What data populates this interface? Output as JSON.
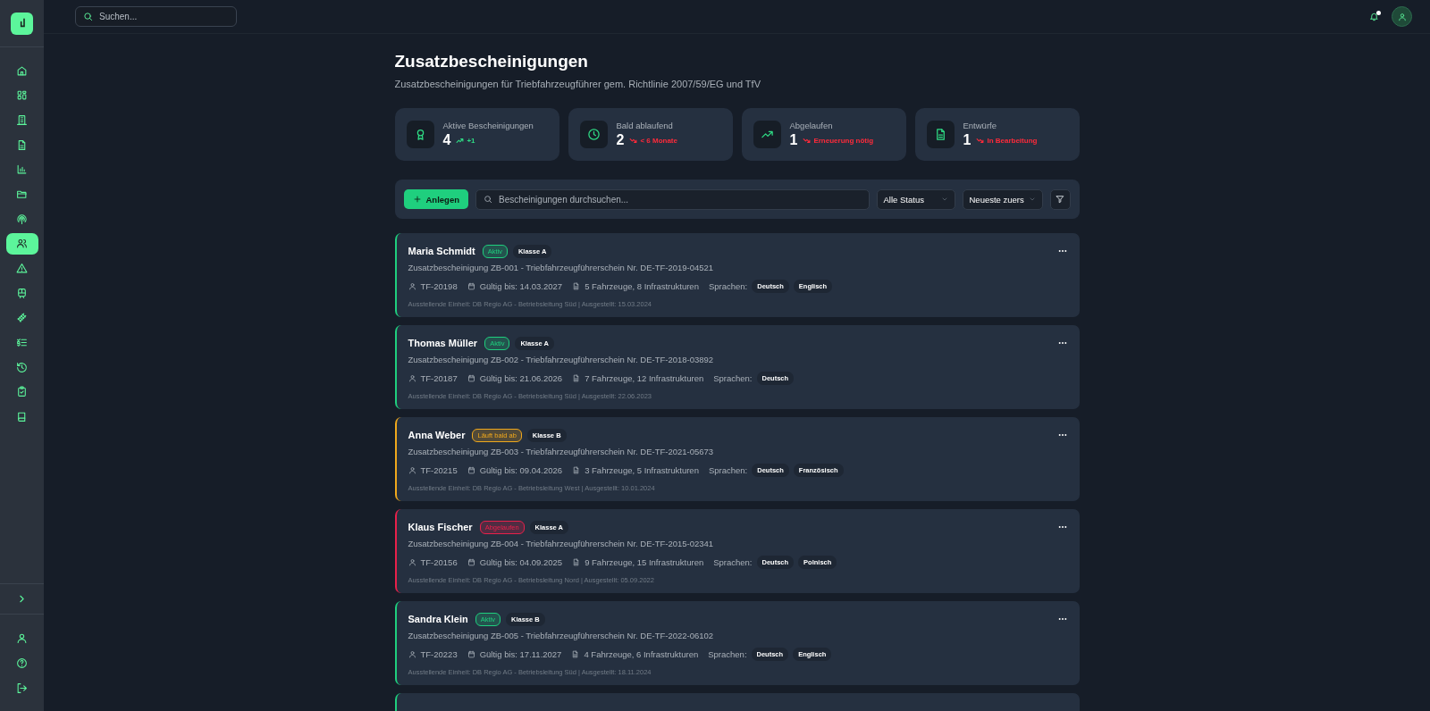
{
  "search": {
    "placeholder": "Suchen..."
  },
  "sidebar": {
    "items": [
      {
        "selected": false
      },
      {
        "selected": false
      },
      {
        "selected": false
      },
      {
        "selected": false
      },
      {
        "selected": false
      },
      {
        "selected": false
      },
      {
        "selected": false
      },
      {
        "selected": true
      },
      {
        "selected": false
      },
      {
        "selected": false
      },
      {
        "selected": false
      },
      {
        "selected": false
      },
      {
        "selected": false
      },
      {
        "selected": false
      },
      {
        "selected": false
      }
    ]
  },
  "header": {
    "notification": true
  },
  "page": {
    "title": "Zusatzbescheinigungen",
    "subtitle": "Zusatzbescheinigungen für Triebfahrzeugführer gem. Richtlinie 2007/59/EG und TfV"
  },
  "stats": [
    {
      "label": "Aktive Bescheinigungen",
      "value": "4",
      "color": "#2fdc85",
      "note": "+1"
    },
    {
      "label": "Bald ablaufend",
      "value": "2",
      "color": "#ff2a3a",
      "note": "< 6 Monate"
    },
    {
      "label": "Abgelaufen",
      "value": "1",
      "color": "#ff2a3a",
      "note": "Erneuerung nötig"
    },
    {
      "label": "Entwürfe",
      "value": "1",
      "color": "#ff2a3a",
      "note": "In Bearbeitung"
    }
  ],
  "toolbar": {
    "create_button": "Anlegen",
    "search_placeholder": "Bescheinigungen durchsuchen...",
    "status_filter": "Alle Status",
    "sort": "Neueste zuers"
  },
  "certificates": [
    {
      "name": "Maria Schmidt",
      "color": "#1fcf7e",
      "status_label": "Aktiv",
      "class": "Klasse A",
      "title": "Zusatzbescheinigung ZB-001 - Triebfahrzeugführerschein Nr. DE-TF-2019-04521",
      "id": "TF-20198",
      "valid": "Gültig bis: 14.03.2027",
      "scope": "5 Fahrzeuge, 8 Infrastrukturen",
      "languages_label": "Sprachen:",
      "languages": [
        "Deutsch",
        "Englisch"
      ],
      "issuer": "Ausstellende Einheit: DB Regio AG - Betriebsleitung Süd | Ausgestellt: 15.03.2024"
    },
    {
      "name": "Thomas Müller",
      "color": "#1fcf7e",
      "status_label": "Aktiv",
      "class": "Klasse A",
      "title": "Zusatzbescheinigung ZB-002 - Triebfahrzeugführerschein Nr. DE-TF-2018-03892",
      "id": "TF-20187",
      "valid": "Gültig bis: 21.06.2026",
      "scope": "7 Fahrzeuge, 12 Infrastrukturen",
      "languages_label": "Sprachen:",
      "languages": [
        "Deutsch"
      ],
      "issuer": "Ausstellende Einheit: DB Regio AG - Betriebsleitung Süd | Ausgestellt: 22.06.2023"
    },
    {
      "name": "Anna Weber",
      "color": "#f0a81c",
      "status_label": "Läuft bald ab",
      "class": "Klasse B",
      "title": "Zusatzbescheinigung ZB-003 - Triebfahrzeugführerschein Nr. DE-TF-2021-05673",
      "id": "TF-20215",
      "valid": "Gültig bis: 09.04.2026",
      "scope": "3 Fahrzeuge, 5 Infrastrukturen",
      "languages_label": "Sprachen:",
      "languages": [
        "Deutsch",
        "Französisch"
      ],
      "issuer": "Ausstellende Einheit: DB Regio AG - Betriebsleitung West | Ausgestellt: 10.01.2024"
    },
    {
      "name": "Klaus Fischer",
      "color": "#e8204a",
      "status_label": "Abgelaufen",
      "class": "Klasse A",
      "title": "Zusatzbescheinigung ZB-004 - Triebfahrzeugführerschein Nr. DE-TF-2015-02341",
      "id": "TF-20156",
      "valid": "Gültig bis: 04.09.2025",
      "scope": "9 Fahrzeuge, 15 Infrastrukturen",
      "languages_label": "Sprachen:",
      "languages": [
        "Deutsch",
        "Polnisch"
      ],
      "issuer": "Ausstellende Einheit: DB Regio AG - Betriebsleitung Nord | Ausgestellt: 05.09.2022"
    },
    {
      "name": "Sandra Klein",
      "color": "#1fcf7e",
      "status_label": "Aktiv",
      "class": "Klasse B",
      "title": "Zusatzbescheinigung ZB-005 - Triebfahrzeugführerschein Nr. DE-TF-2022-06102",
      "id": "TF-20223",
      "valid": "Gültig bis: 17.11.2027",
      "scope": "4 Fahrzeuge, 6 Infrastrukturen",
      "languages_label": "Sprachen:",
      "languages": [
        "Deutsch",
        "Englisch"
      ],
      "issuer": "Ausstellende Einheit: DB Regio AG - Betriebsleitung Süd | Ausgestellt: 18.11.2024"
    },
    {
      "color": "#1fcf7e"
    }
  ]
}
